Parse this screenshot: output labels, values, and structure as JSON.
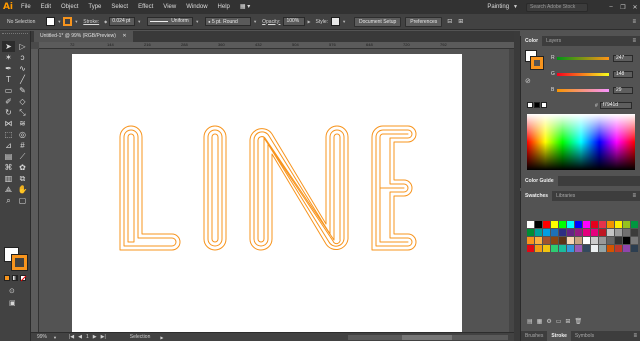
{
  "menubar": {
    "logo": "Ai",
    "items": [
      "File",
      "Edit",
      "Object",
      "Type",
      "Select",
      "Effect",
      "View",
      "Window",
      "Help"
    ],
    "workspace": "Painting",
    "search_placeholder": "Search Adobe Stock",
    "window_buttons": [
      "–",
      "❐",
      "✕"
    ]
  },
  "control": {
    "selection_label": "No Selection",
    "fill_color": "#ffffff",
    "stroke_color": "#f7941d",
    "stroke_label": "Stroke:",
    "stroke_weight": "0.024 pt",
    "stroke_profile": "Uniform",
    "brush": "5 pt. Round",
    "opacity_label": "Opacity:",
    "opacity_value": "100%",
    "style_label": "Style:",
    "doc_setup": "Document Setup",
    "preferences": "Preferences"
  },
  "document": {
    "tab_title": "Untitled-1* @ 99% (RGB/Preview)",
    "ruler_ticks": [
      "72",
      "144",
      "216",
      "288",
      "360",
      "432",
      "504",
      "576",
      "648",
      "720",
      "792"
    ],
    "artwork_text": "LINE",
    "stroke_color": "#f7941d"
  },
  "status": {
    "zoom": "99%",
    "page": "1",
    "mode": "Selection"
  },
  "color_panel": {
    "tabs": [
      "Color",
      "Layers"
    ],
    "r": "247",
    "g": "148",
    "b": "29",
    "hex_prefix": "#",
    "hex": "f7941d"
  },
  "color_guide_tab": "Color Guide",
  "swatches_panel": {
    "tabs": [
      "Swatches",
      "Libraries"
    ],
    "bottom_tabs": [
      "Brushes",
      "Stroke",
      "Symbols"
    ]
  },
  "icons": {
    "tools": [
      "selection-tool",
      "direct-selection-tool",
      "magic-wand-tool",
      "lasso-tool",
      "pen-tool",
      "curvature-tool",
      "type-tool",
      "line-tool",
      "rectangle-tool",
      "paintbrush-tool",
      "shaper-tool",
      "eraser-tool",
      "rotate-tool",
      "scale-tool",
      "width-tool",
      "warp-tool",
      "free-transform-tool",
      "shape-builder-tool",
      "perspective-tool",
      "mesh-tool",
      "gradient-tool",
      "eyedropper-tool",
      "blend-tool",
      "symbol-sprayer-tool",
      "graph-tool",
      "artboard-tool",
      "slice-tool",
      "hand-tool",
      "zoom-tool",
      "draw-mode-tool"
    ]
  }
}
